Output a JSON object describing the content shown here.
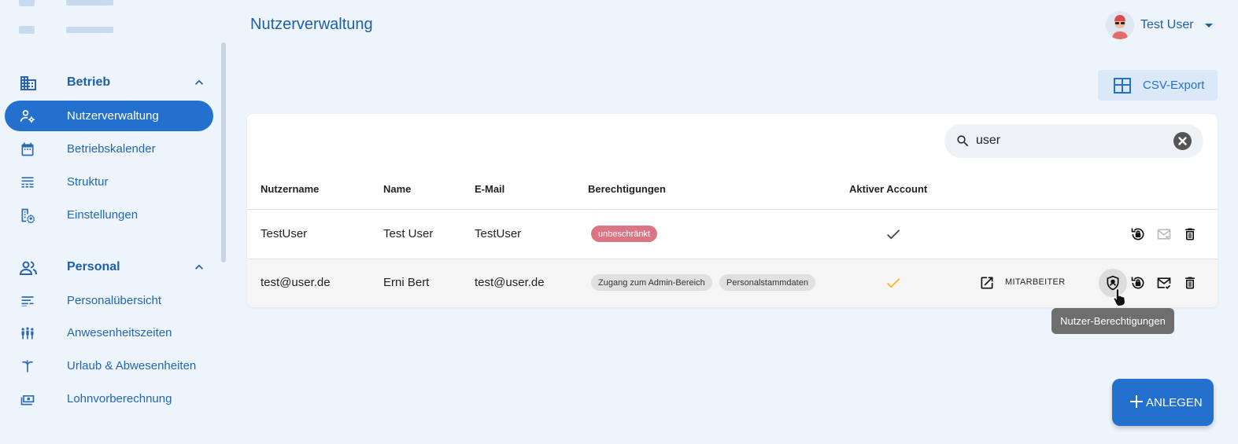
{
  "page": {
    "title": "Nutzerverwaltung"
  },
  "user_menu": {
    "name": "Test User"
  },
  "sidebar": {
    "sections": [
      {
        "label": "Betrieb",
        "icon": "building-icon"
      },
      {
        "label": "Personal",
        "icon": "people-icon"
      }
    ],
    "items": [
      {
        "label": "Nutzerverwaltung",
        "icon": "user-settings-icon",
        "active": true
      },
      {
        "label": "Betriebskalender",
        "icon": "calendar-icon"
      },
      {
        "label": "Struktur",
        "icon": "structure-icon"
      },
      {
        "label": "Einstellungen",
        "icon": "building-gear-icon"
      },
      {
        "label": "Personalübersicht",
        "icon": "list-icon"
      },
      {
        "label": "Anwesenheitszeiten",
        "icon": "group-icon"
      },
      {
        "label": "Urlaub & Abwesenheiten",
        "icon": "palm-icon"
      },
      {
        "label": "Lohnvorberechnung",
        "icon": "money-icon"
      }
    ]
  },
  "toolbar": {
    "csv_label": "CSV-Export",
    "add_label": "ANLEGEN"
  },
  "search": {
    "value": "user"
  },
  "table": {
    "columns": [
      "Nutzername",
      "Name",
      "E-Mail",
      "Berechtigungen",
      "Aktiver Account"
    ],
    "rows": [
      {
        "username": "TestUser",
        "name": "Test User",
        "email": "TestUser",
        "permissions": [
          "unbeschränkt"
        ],
        "active": true,
        "check_color": "#444444"
      },
      {
        "username": "test@user.de",
        "name": "Erni Bert",
        "email": "test@user.de",
        "permissions": [
          "Zugang zum Admin-Bereich",
          "Personalstammdaten"
        ],
        "active": true,
        "check_color": "#f5b629",
        "employee_link": "MITARBEITER"
      }
    ]
  },
  "tooltip": {
    "text": "Nutzer-Berechtigungen"
  },
  "colors": {
    "accent": "#2470cf",
    "chip_red": "#dc7583",
    "check_yellow": "#f5b629"
  }
}
